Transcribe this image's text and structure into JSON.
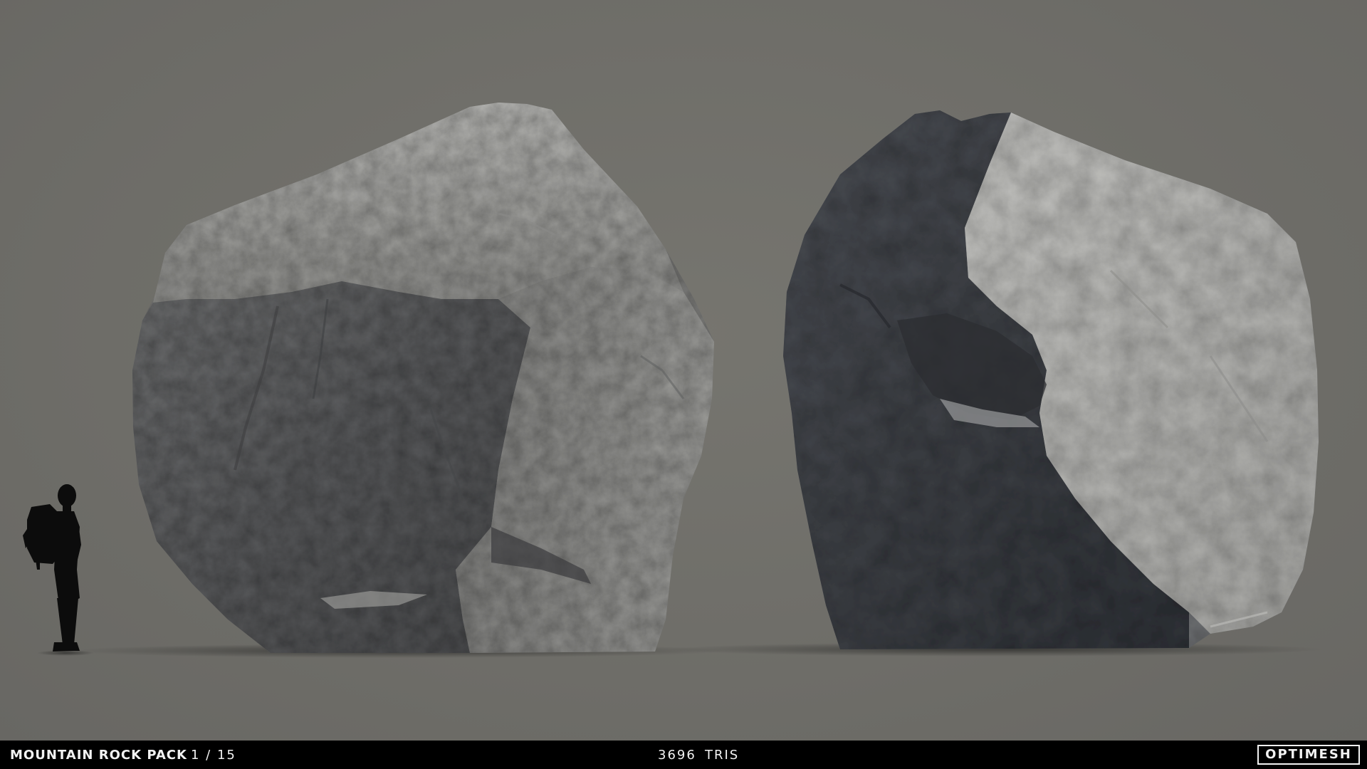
{
  "scene": {
    "background_color": "#6f6e6a",
    "objects": [
      {
        "name": "person-silhouette",
        "description_icon": "hiker-with-backpack"
      },
      {
        "name": "rock-left"
      },
      {
        "name": "rock-right"
      }
    ]
  },
  "footer": {
    "background_color": "#000000",
    "pack_title": "MOUNTAIN ROCK PACK",
    "pack_index": "1 / 15",
    "tri_count": "3696",
    "tri_label": "TRIS",
    "brand": "OPTIMESH"
  }
}
